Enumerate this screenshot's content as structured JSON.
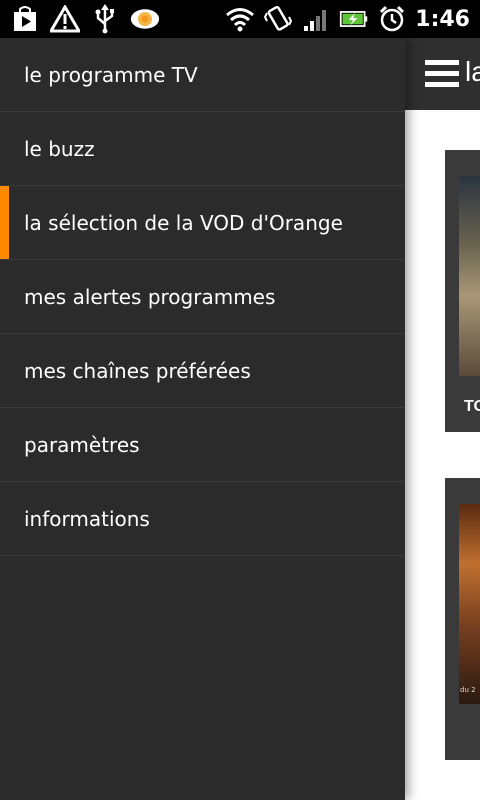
{
  "status_bar": {
    "time": "1:46",
    "left_icons": [
      "play-store-icon",
      "warning-icon",
      "usb-icon",
      "eye-icon"
    ],
    "right_icons": [
      "wifi-icon",
      "vibrate-icon",
      "signal-icon",
      "battery-charging-icon",
      "alarm-icon"
    ]
  },
  "content": {
    "header_title": "la",
    "cards": [
      {
        "label": "TO"
      },
      {
        "date_text": "du 2"
      }
    ]
  },
  "drawer": {
    "items": [
      {
        "label": "le programme TV",
        "active": false
      },
      {
        "label": "le buzz",
        "active": false
      },
      {
        "label": "la sélection de la VOD d'Orange",
        "active": true
      },
      {
        "label": "mes alertes programmes",
        "active": false
      },
      {
        "label": "mes chaînes préférées",
        "active": false
      },
      {
        "label": "paramètres",
        "active": false
      },
      {
        "label": "informations",
        "active": false
      }
    ],
    "accent_color": "#ff8a00"
  }
}
